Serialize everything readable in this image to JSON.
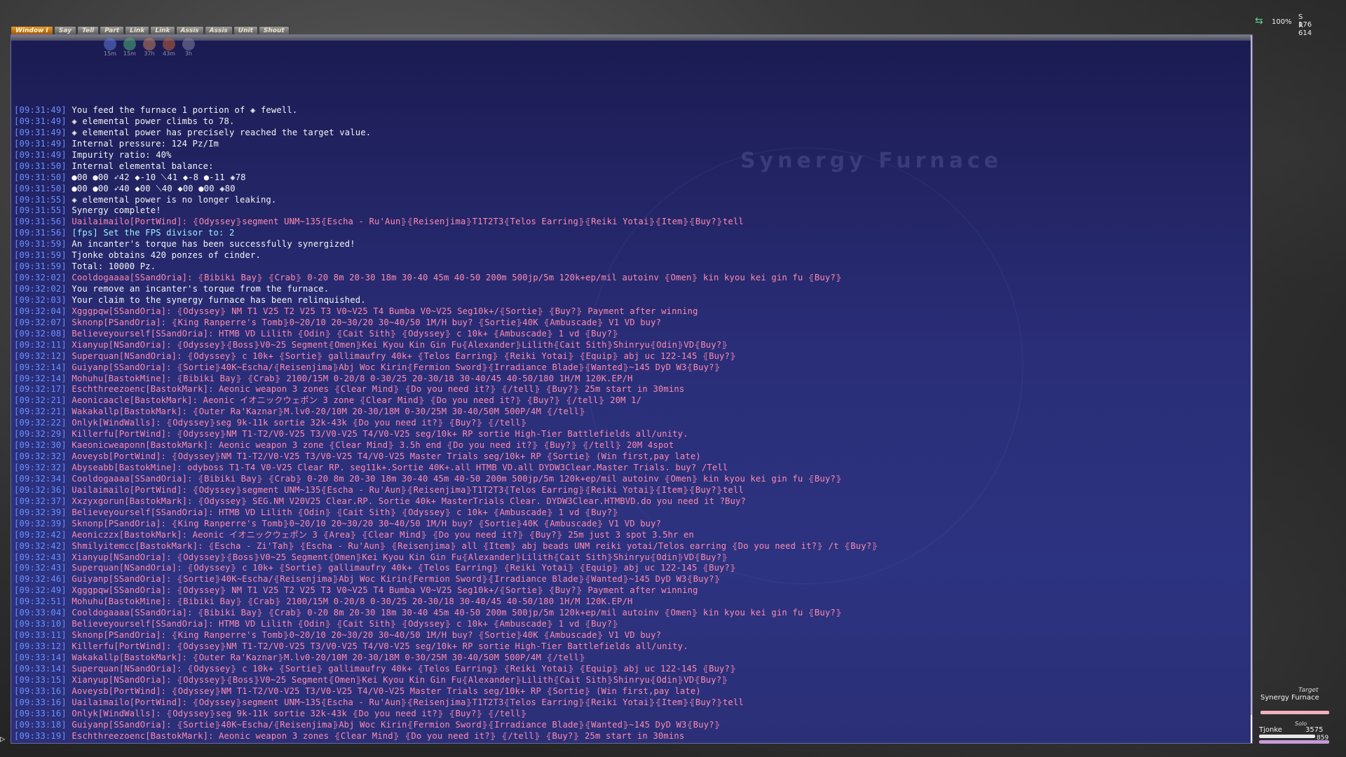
{
  "tabs": [
    {
      "label": "Window I",
      "active": true
    },
    {
      "label": "Say",
      "active": false
    },
    {
      "label": "Tell",
      "active": false
    },
    {
      "label": "Part",
      "active": false
    },
    {
      "label": "Link",
      "active": false
    },
    {
      "label": "Link",
      "active": false
    },
    {
      "label": "Assis",
      "active": false
    },
    {
      "label": "Assis",
      "active": false
    },
    {
      "label": "Unit",
      "active": false
    },
    {
      "label": "Shout",
      "active": false
    }
  ],
  "status_effects": [
    {
      "icon": "buff-icon",
      "timer": "15m",
      "color": "#5f7ad8"
    },
    {
      "icon": "buff-icon",
      "timer": "15m",
      "color": "#4fb07a"
    },
    {
      "icon": "buff-icon",
      "timer": "37h",
      "color": "#c28060"
    },
    {
      "icon": "buff-icon",
      "timer": "43m",
      "color": "#c06040"
    },
    {
      "icon": "buff-icon",
      "timer": "3h",
      "color": "#8080a0"
    }
  ],
  "watermark": "Synergy Furnace",
  "compass": {
    "pct": "100%",
    "s": "S 176",
    "r": "R 614"
  },
  "target": {
    "header": "Target",
    "name": "Synergy Furnace"
  },
  "party": {
    "header": "Solo",
    "name": "Tjonke",
    "hp": "3575",
    "tp": "859"
  },
  "chat_lines": [
    {
      "t": "09:31:49",
      "c": "white",
      "m": "You feed the furnace 1 portion of ◈ fewell."
    },
    {
      "t": "09:31:49",
      "c": "white",
      "m": "◈ elemental power climbs to 78."
    },
    {
      "t": "09:31:49",
      "c": "white",
      "m": "◈ elemental power has precisely reached the target value."
    },
    {
      "t": "09:31:49",
      "c": "white",
      "m": "Internal pressure: 124 Pz/Im"
    },
    {
      "t": "09:31:49",
      "c": "white",
      "m": "Impurity ratio: 40%"
    },
    {
      "t": "09:31:50",
      "c": "white",
      "m": "Internal elemental balance:"
    },
    {
      "t": "09:31:50",
      "c": "white",
      "m": "●00 ●00 ➶42 ◆-10 ⟍41 ◆-8 ●-11 ◈78"
    },
    {
      "t": "09:31:50",
      "c": "white",
      "m": "●00 ●00 ➶40 ◆00 ⟍40 ◆00 ●00 ◈80"
    },
    {
      "t": "09:31:55",
      "c": "white",
      "m": "◈ elemental power is no longer leaking."
    },
    {
      "t": "09:31:55",
      "c": "white",
      "m": "Synergy complete!"
    },
    {
      "t": "09:31:56",
      "c": "pink",
      "m": "Uailaimailo[PortWind]: ⦃Odyssey⦄segment UNM~135⦃Escha - Ru'Aun⦄⦃Reisenjima⦄T1T2T3⦃Telos Earring⦄⦃Reiki Yotai⦄⦃Item⦄⦃Buy?⦄tell"
    },
    {
      "t": "09:31:56",
      "c": "fps",
      "m": "[fps] Set the FPS divisor to: 2"
    },
    {
      "t": "09:31:59",
      "c": "white",
      "m": "An incanter's torque has been successfully synergized!"
    },
    {
      "t": "09:31:59",
      "c": "white",
      "m": "Tjonke obtains 420 ponzes of cinder."
    },
    {
      "t": "09:31:59",
      "c": "white",
      "m": "Total: 10000 Pz."
    },
    {
      "t": "09:32:02",
      "c": "pink",
      "m": "Cooldogaaaa[SSandOria]: ⦃Bibiki Bay⦄ ⦃Crab⦄ 0-20 8m 20-30 18m 30-40 45m 40-50 200m 500jp/5m 120k+ep/mil autoinv ⦃Omen⦄ kin kyou kei gin fu ⦃Buy?⦄"
    },
    {
      "t": "09:32:02",
      "c": "white",
      "m": "You remove an incanter's torque from the furnace."
    },
    {
      "t": "09:32:03",
      "c": "white",
      "m": "Your claim to the synergy furnace has been relinquished."
    },
    {
      "t": "09:32:04",
      "c": "pink",
      "m": "Xgggpqw[SSandOria]: ⦃Odyssey⦄ NM T1 V25 T2 V25 T3 V0~V25 T4 Bumba V0~V25 Seg10k+/⦃Sortie⦄ ⦃Buy?⦄ Payment after winning"
    },
    {
      "t": "09:32:07",
      "c": "pink",
      "m": "Sknonp[PSandOria]: ⦃King Ranperre's Tomb⦄0~20/10 20~30/20 30~40/50 1M/H buy? ⦃Sortie⦄40K ⦃Ambuscade⦄ V1 VD buy?"
    },
    {
      "t": "09:32:08",
      "c": "pink",
      "m": "Believeyourself[SSandOria]: HTMB VD Lilith ⦃Odin⦄ ⦃Cait Sith⦄ ⦃Odyssey⦄ c 10k+ ⦃Ambuscade⦄ 1 vd ⦃Buy?⦄"
    },
    {
      "t": "09:32:11",
      "c": "pink",
      "m": "Xianyup[NSandOria]: ⦃Odyssey⦄⦃Boss⦄V0~25 Segment⦃Omen⦄Kei Kyou Kin Gin Fu⦃Alexander⦄Lilith⦃Cait Sith⦄Shinryu⦃Odin⦄VD⦃Buy?⦄"
    },
    {
      "t": "09:32:12",
      "c": "pink",
      "m": "Superquan[NSandOria]: ⦃Odyssey⦄ c 10k+ ⦃Sortie⦄ gallimaufry 40k+ ⦃Telos Earring⦄ ⦃Reiki Yotai⦄ ⦃Equip⦄ abj uc 122-145 ⦃Buy?⦄"
    },
    {
      "t": "09:32:14",
      "c": "pink",
      "m": "Guiyanp[SSandOria]: ⦃Sortie⦄40K~Escha/⦃Reisenjima⦄Abj Woc Kirin⦃Fermion Sword⦄⦃Irradiance Blade⦄⦃Wanted⦄~145 DyD W3⦃Buy?⦄"
    },
    {
      "t": "09:32:14",
      "c": "pink",
      "m": "Mohuhu[BastokMine]: ⦃Bibiki Bay⦄ ⦃Crab⦄ 2100/15M 0-20/8 0-30/25 20-30/18 30-40/45 40-50/180 1H/M 120K.EP/H"
    },
    {
      "t": "09:32:17",
      "c": "pink",
      "m": "Eschthreezoenc[BastokMark]: Aeonic weapon 3 zones ⦃Clear Mind⦄ ⦃Do you need it?⦄ ⦃/tell⦄ ⦃Buy?⦄  25m   start in 30mins"
    },
    {
      "t": "09:32:21",
      "c": "pink",
      "m": "Aeonicaacle[BastokMark]: Aeonic イオニックウェポン 3 zone ⦃Clear Mind⦄ ⦃Do you need it?⦄ ⦃Buy?⦄ ⦃/tell⦄  20M       1/"
    },
    {
      "t": "09:32:21",
      "c": "pink",
      "m": "Wakakallp[BastokMark]: ⦃Outer Ra'Kaznar⦄M.lv0-20/10M 20-30/18M 0-30/25M 30-40/50M 500P/4M ⦃/tell⦄"
    },
    {
      "t": "09:32:22",
      "c": "pink",
      "m": "Onlyk[WindWalls]: ⦃Odyssey⦄seg 9k-11k sortie 32k-43k ⦃Do you need it?⦄ ⦃Buy?⦄ ⦃/tell⦄"
    },
    {
      "t": "09:32:29",
      "c": "pink",
      "m": "Killerfu[PortWind]: ⦃Odyssey⦄NM T1-T2/V0-V25 T3/V0-V25 T4/V0-V25 seg/10k+ RP sortie High-Tier Battlefields all/unity."
    },
    {
      "t": "09:32:30",
      "c": "pink",
      "m": "Kaeonicweaponn[BastokMark]: Aeonic weapon 3 zone ⦃Clear Mind⦄ 3.5h end ⦃Do you need it?⦄ ⦃Buy?⦄ ⦃/tell⦄  20M  4spot"
    },
    {
      "t": "09:32:32",
      "c": "pink",
      "m": "Aoveysb[PortWind]: ⦃Odyssey⦄NM T1-T2/V0-V25 T3/V0-V25 T4/V0-V25 Master Trials seg/10k+ RP ⦃Sortie⦄ (Win first,pay late)"
    },
    {
      "t": "09:32:32",
      "c": "pink",
      "m": "Abyseabb[BastokMine]: odyboss T1-T4 V0-V25 Clear RP. seg11k+.Sortie 40K+.all HTMB VD.all DYDW3Clear.Master Trials. buy? /Tell"
    },
    {
      "t": "09:32:34",
      "c": "pink",
      "m": "Cooldogaaaa[SSandOria]: ⦃Bibiki Bay⦄ ⦃Crab⦄ 0-20 8m 20-30 18m 30-40 45m 40-50 200m 500jp/5m 120k+ep/mil autoinv ⦃Omen⦄ kin kyou kei gin fu ⦃Buy?⦄"
    },
    {
      "t": "09:32:36",
      "c": "pink",
      "m": "Uailaimailo[PortWind]: ⦃Odyssey⦄segment UNM~135⦃Escha - Ru'Aun⦄⦃Reisenjima⦄T1T2T3⦃Telos Earring⦄⦃Reiki Yotai⦄⦃Item⦄⦃Buy?⦄tell"
    },
    {
      "t": "09:32:37",
      "c": "pink",
      "m": "Xxzyxgorun[BastokMark]: ⦃Odyssey⦄ SEG.NM V20V25 Clear.RP. Sortie 40k+ MasterTrials Clear. DYDW3Clear.HTMBVD.do you need it ?Buy?"
    },
    {
      "t": "09:32:39",
      "c": "pink",
      "m": "Believeyourself[SSandOria]: HTMB VD Lilith ⦃Odin⦄ ⦃Cait Sith⦄ ⦃Odyssey⦄ c 10k+ ⦃Ambuscade⦄ 1 vd ⦃Buy?⦄"
    },
    {
      "t": "09:32:39",
      "c": "pink",
      "m": "Sknonp[PSandOria]: ⦃King Ranperre's Tomb⦄0~20/10 20~30/20 30~40/50 1M/H buy? ⦃Sortie⦄40K ⦃Ambuscade⦄ V1 VD buy?"
    },
    {
      "t": "09:32:42",
      "c": "pink",
      "m": "Aeoniczzx[BastokMark]: Aeonic イオニックウェポン 3 ⦃Area⦄ ⦃Clear Mind⦄ ⦃Do you need it?⦄ ⦃Buy?⦄ 25m just 3 spot 3.5hr en"
    },
    {
      "t": "09:32:42",
      "c": "pink",
      "m": "Shmilyitemcc[BastokMark]: ⦃Escha - Zi'Tah⦄ ⦃Escha - Ru'Aun⦄ ⦃Reisenjima⦄ all ⦃Item⦄ abj beads UNM reiki yotai/Telos earring ⦃Do you need it?⦄ /t ⦃Buy?⦄"
    },
    {
      "t": "09:32:43",
      "c": "pink",
      "m": "Xianyup[NSandOria]: ⦃Odyssey⦄⦃Boss⦄V0~25 Segment⦃Omen⦄Kei Kyou Kin Gin Fu⦃Alexander⦄Lilith⦃Cait Sith⦄Shinryu⦃Odin⦄VD⦃Buy?⦄"
    },
    {
      "t": "09:32:43",
      "c": "pink",
      "m": "Superquan[NSandOria]: ⦃Odyssey⦄ c 10k+ ⦃Sortie⦄ gallimaufry 40k+ ⦃Telos Earring⦄ ⦃Reiki Yotai⦄ ⦃Equip⦄ abj uc 122-145 ⦃Buy?⦄"
    },
    {
      "t": "09:32:46",
      "c": "pink",
      "m": "Guiyanp[SSandOria]: ⦃Sortie⦄40K~Escha/⦃Reisenjima⦄Abj Woc Kirin⦃Fermion Sword⦄⦃Irradiance Blade⦄⦃Wanted⦄~145 DyD W3⦃Buy?⦄"
    },
    {
      "t": "09:32:49",
      "c": "pink",
      "m": "Xgggpqw[SSandOria]: ⦃Odyssey⦄ NM T1 V25 T2 V25 T3 V0~V25 T4 Bumba V0~V25 Seg10k+/⦃Sortie⦄ ⦃Buy?⦄ Payment after winning"
    },
    {
      "t": "09:32:51",
      "c": "pink",
      "m": "Mohuhu[BastokMine]: ⦃Bibiki Bay⦄ ⦃Crab⦄ 2100/15M 0-20/8 0-30/25 20-30/18 30-40/45 40-50/180 1H/M 120K.EP/H"
    },
    {
      "t": "09:33:04",
      "c": "pink",
      "m": "Cooldogaaaa[SSandOria]: ⦃Bibiki Bay⦄ ⦃Crab⦄ 0-20 8m 20-30 18m 30-40 45m 40-50 200m 500jp/5m 120k+ep/mil autoinv ⦃Omen⦄ kin kyou kei gin fu ⦃Buy?⦄"
    },
    {
      "t": "09:33:10",
      "c": "pink",
      "m": "Believeyourself[SSandOria]: HTMB VD Lilith ⦃Odin⦄ ⦃Cait Sith⦄ ⦃Odyssey⦄ c 10k+ ⦃Ambuscade⦄ 1 vd ⦃Buy?⦄"
    },
    {
      "t": "09:33:11",
      "c": "pink",
      "m": "Sknonp[PSandOria]: ⦃King Ranperre's Tomb⦄0~20/10 20~30/20 30~40/50 1M/H buy? ⦃Sortie⦄40K ⦃Ambuscade⦄ V1 VD buy?"
    },
    {
      "t": "09:33:12",
      "c": "pink",
      "m": "Killerfu[PortWind]: ⦃Odyssey⦄NM T1-T2/V0-V25 T3/V0-V25 T4/V0-V25 seg/10k+ RP sortie High-Tier Battlefields all/unity."
    },
    {
      "t": "09:33:14",
      "c": "pink",
      "m": "Wakakallp[BastokMark]: ⦃Outer Ra'Kaznar⦄M.lv0-20/10M 20-30/18M 0-30/25M 30-40/50M 500P/4M ⦃/tell⦄"
    },
    {
      "t": "09:33:14",
      "c": "pink",
      "m": "Superquan[NSandOria]: ⦃Odyssey⦄ c 10k+ ⦃Sortie⦄ gallimaufry 40k+ ⦃Telos Earring⦄ ⦃Reiki Yotai⦄ ⦃Equip⦄ abj uc 122-145 ⦃Buy?⦄"
    },
    {
      "t": "09:33:15",
      "c": "pink",
      "m": "Xianyup[NSandOria]: ⦃Odyssey⦄⦃Boss⦄V0~25 Segment⦃Omen⦄Kei Kyou Kin Gin Fu⦃Alexander⦄Lilith⦃Cait Sith⦄Shinryu⦃Odin⦄VD⦃Buy?⦄"
    },
    {
      "t": "09:33:16",
      "c": "pink",
      "m": "Aoveysb[PortWind]: ⦃Odyssey⦄NM T1-T2/V0-V25 T3/V0-V25 T4/V0-V25 Master Trials seg/10k+ RP ⦃Sortie⦄ (Win first,pay late)"
    },
    {
      "t": "09:33:16",
      "c": "pink",
      "m": "Uailaimailo[PortWind]: ⦃Odyssey⦄segment UNM~135⦃Escha - Ru'Aun⦄⦃Reisenjima⦄T1T2T3⦃Telos Earring⦄⦃Reiki Yotai⦄⦃Item⦄⦃Buy?⦄tell"
    },
    {
      "t": "09:33:16",
      "c": "pink",
      "m": "Onlyk[WindWalls]: ⦃Odyssey⦄seg 9k-11k sortie 32k-43k ⦃Do you need it?⦄ ⦃Buy?⦄ ⦃/tell⦄"
    },
    {
      "t": "09:33:18",
      "c": "pink",
      "m": "Guiyanp[SSandOria]: ⦃Sortie⦄40K~Escha/⦃Reisenjima⦄Abj Woc Kirin⦃Fermion Sword⦄⦃Irradiance Blade⦄⦃Wanted⦄~145 DyD W3⦃Buy?⦄"
    },
    {
      "t": "09:33:19",
      "c": "pink",
      "m": "Eschthreezoenc[BastokMark]: Aeonic weapon 3 zones ⦃Clear Mind⦄ ⦃Do you need it?⦄ ⦃/tell⦄ ⦃Buy?⦄  25m   start in 30mins"
    }
  ]
}
